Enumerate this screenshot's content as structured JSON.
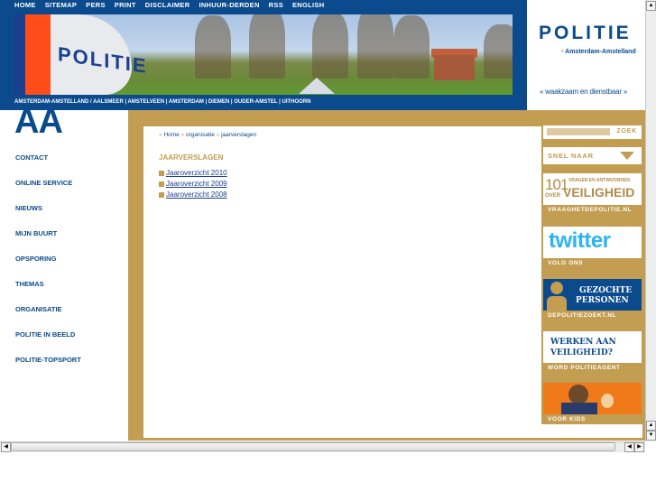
{
  "topnav": [
    "HOME",
    "SITEMAP",
    "PERS",
    "PRINT",
    "DISCLAIMER",
    "INHUUR-DERDEN",
    "RSS",
    "ENGLISH"
  ],
  "banner": {
    "car_text": "POLITIE"
  },
  "places": "AMSTERDAM-AMSTELLAND / AALSMEER | AMSTELVEEN | AMSTERDAM | DIEMEN | OUDER-AMSTEL | UITHOORN",
  "logo": {
    "name": "POLITIE",
    "region": "Amsterdam-Amstelland",
    "slogan": "« waakzaam en dienstbaar »"
  },
  "region_abbr": "AA",
  "sidebar": [
    "CONTACT",
    "ONLINE SERVICE",
    "NIEUWS",
    "MIJN BUURT",
    "OPSPORING",
    "THEMAS",
    "ORGANISATIE",
    "POLITIE IN BEELD",
    "POLITIE-TOPSPORT"
  ],
  "breadcrumb": [
    "Home",
    "organisatie",
    "jaarverslagen"
  ],
  "breadcrumb_sep": "»",
  "page_title": "JAARVERSLAGEN",
  "documents": [
    "Jaaroverzicht 2010",
    "Jaaroverzicht 2009",
    "Jaaroverzicht 2008"
  ],
  "widgets": {
    "search_label": "ZOEK",
    "quick_label": "SNEL NAAR",
    "faq": {
      "num": "101",
      "over": "OVER",
      "top": "VRAGEN EN ANTWOORDEN",
      "big": "VEILIGHEID",
      "caption": "VRAAGHETDEPOLITIE.NL"
    },
    "twitter": {
      "logo": "twitter",
      "caption": "VOLG ONS"
    },
    "wanted": {
      "title1": "GEZOCHTE",
      "title2": "PERSONEN",
      "caption": "DEPOLITIEZOEKT.NL"
    },
    "jobs": {
      "title1": "WERKEN AAN",
      "title2": "VEILIGHEID?",
      "caption": "WORD POLITIEAGENT"
    },
    "kids": {
      "caption": "VOOR KIDS"
    }
  },
  "colors": {
    "brand_blue": "#0b4a8c",
    "gold": "#c29d52",
    "twitter": "#29b6f0",
    "kids_orange": "#f07a1a"
  }
}
